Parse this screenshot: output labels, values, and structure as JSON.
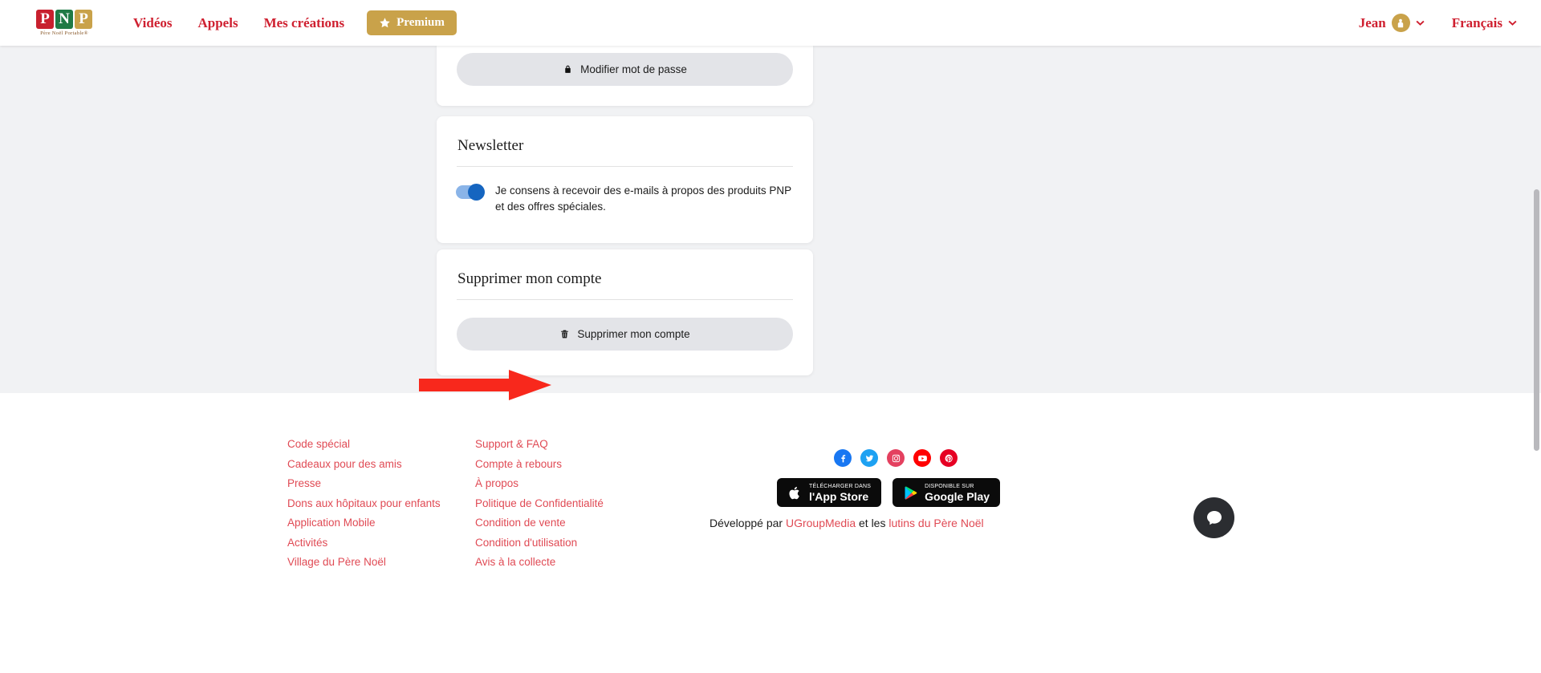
{
  "header": {
    "logo": {
      "tiles": [
        "P",
        "N",
        "P"
      ],
      "tagline": "Père Noël Portable®"
    },
    "nav": [
      {
        "label": "Vidéos"
      },
      {
        "label": "Appels"
      },
      {
        "label": "Mes créations"
      }
    ],
    "premium_label": "Premium",
    "user": {
      "name": "Jean",
      "avatar_icon": "elf-avatar-icon"
    },
    "language": {
      "label": "Français"
    },
    "colors": {
      "brand_red": "#cf2030",
      "gold": "#c9a24a",
      "link_red": "#e04a54"
    }
  },
  "main": {
    "password_card": {
      "button_label": "Modifier mot de passe",
      "button_icon": "lock-icon"
    },
    "newsletter_card": {
      "title": "Newsletter",
      "consent_text": "Je consens à recevoir des e-mails à propos des produits PNP et des offres spéciales.",
      "toggle_state": "on",
      "toggle_color": "#1565c0"
    },
    "delete_card": {
      "title": "Supprimer mon compte",
      "button_label": "Supprimer mon compte",
      "button_icon": "trash-icon"
    },
    "annotation": {
      "type": "arrow",
      "color": "#f8281c",
      "points_to": "Supprimer mon compte"
    }
  },
  "footer": {
    "column_1": [
      {
        "label": "Code spécial"
      },
      {
        "label": "Cadeaux pour des amis"
      },
      {
        "label": "Presse"
      },
      {
        "label": "Dons aux hôpitaux pour enfants"
      },
      {
        "label": "Application Mobile"
      },
      {
        "label": "Activités"
      },
      {
        "label": "Village du Père Noël"
      }
    ],
    "column_2": [
      {
        "label": "Support & FAQ"
      },
      {
        "label": "Compte à rebours"
      },
      {
        "label": "À propos"
      },
      {
        "label": "Politique de Confidentialité"
      },
      {
        "label": "Condition de vente"
      },
      {
        "label": "Condition d'utilisation"
      },
      {
        "label": "Avis à la collecte"
      }
    ],
    "socials": [
      {
        "name": "facebook-icon",
        "color": "#1877f2"
      },
      {
        "name": "twitter-icon",
        "color": "#1da1f2"
      },
      {
        "name": "instagram-icon",
        "color": "#e4405f"
      },
      {
        "name": "youtube-icon",
        "color": "#ff0000"
      },
      {
        "name": "pinterest-icon",
        "color": "#e60023"
      }
    ],
    "app_store": {
      "small": "Télécharger dans",
      "big": "l'App Store"
    },
    "google_play": {
      "small": "Disponible sur",
      "big": "Google Play"
    },
    "developed_by": {
      "prefix": "Développé par ",
      "company": "UGroupMedia",
      "middle": " et les ",
      "elves": "lutins du Père Noël"
    }
  },
  "chat": {
    "icon": "chat-bubble-icon"
  }
}
